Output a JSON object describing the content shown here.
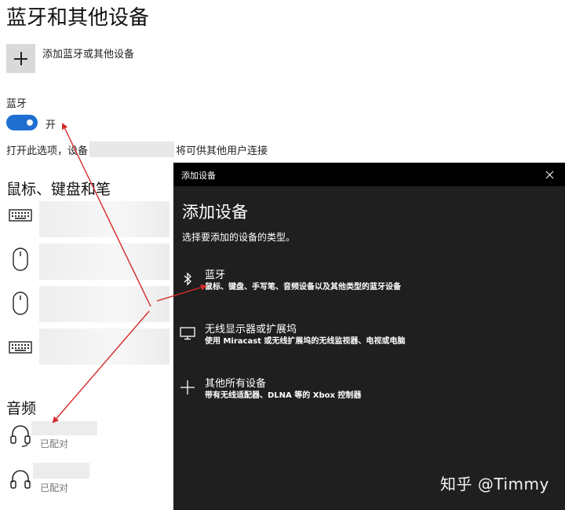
{
  "page": {
    "title": "蓝牙和其他设备"
  },
  "add_device": {
    "label": "添加蓝牙或其他设备"
  },
  "bluetooth": {
    "heading": "蓝牙",
    "toggle_state": "开",
    "discover_prefix": "打开此选项，设备",
    "discover_suffix": "将可供其他用户连接"
  },
  "sections": {
    "input_heading": "鼠标、键盘和笔",
    "audio_heading": "音频"
  },
  "audio_devices": [
    {
      "status": "已配对"
    },
    {
      "status": "已配对"
    }
  ],
  "dialog": {
    "window_title": "添加设备",
    "heading": "添加设备",
    "subtitle": "选择要添加的设备的类型。",
    "options": [
      {
        "icon": "bluetooth-icon",
        "title": "蓝牙",
        "description": "鼠标、键盘、手写笔、音频设备以及其他类型的蓝牙设备"
      },
      {
        "icon": "monitor-icon",
        "title": "无线显示器或扩展坞",
        "description": "使用 Miracast 或无线扩展坞的无线监视器、电视或电脑"
      },
      {
        "icon": "plus-icon",
        "title": "其他所有设备",
        "description": "带有无线适配器、DLNA 等的 Xbox 控制器"
      }
    ]
  },
  "watermark": "知乎 @Timmy",
  "colors": {
    "accent": "#1e6fd0",
    "dialog_bg": "#1f1f1f",
    "titlebar_bg": "#000000",
    "arrow": "#d42a2a"
  }
}
